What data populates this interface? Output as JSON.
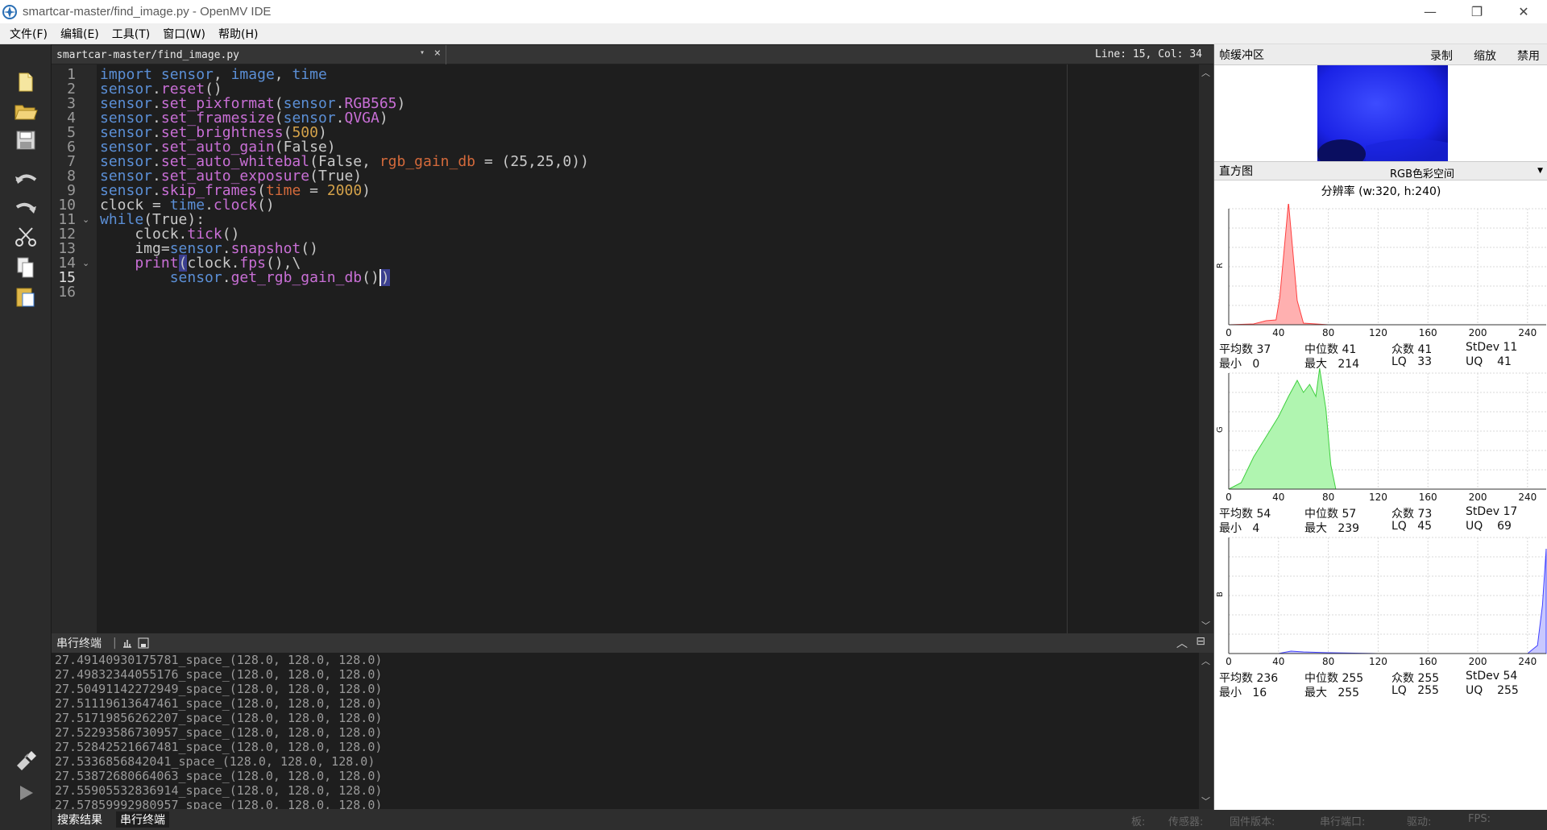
{
  "window": {
    "title": "smartcar-master/find_image.py - OpenMV IDE",
    "minimize": "—",
    "restore": "❐",
    "close": "✕"
  },
  "menu": [
    "文件(F)",
    "编辑(E)",
    "工具(T)",
    "窗口(W)",
    "帮助(H)"
  ],
  "toolbar": {
    "icons": [
      "new-file-icon",
      "open-folder-icon",
      "save-icon",
      "undo-icon",
      "redo-icon",
      "cut-icon",
      "copy-icon",
      "paste-icon",
      "connect-icon",
      "run-icon"
    ]
  },
  "editor": {
    "file_tab": "smartcar-master/find_image.py",
    "tab_dropdown": "▾",
    "tab_close": "×",
    "cursor_pos": "Line: 15, Col: 34",
    "line_numbers": [
      "1",
      "2",
      "3",
      "4",
      "5",
      "6",
      "7",
      "8",
      "9",
      "10",
      "11",
      "12",
      "13",
      "14",
      "15",
      "16"
    ],
    "current_line": 15
  },
  "terminal": {
    "title": "串行终端",
    "lines": [
      "27.49140930175781_space_(128.0, 128.0, 128.0)",
      "27.49832344055176_space_(128.0, 128.0, 128.0)",
      "27.50491142272949_space_(128.0, 128.0, 128.0)",
      "27.51119613647461_space_(128.0, 128.0, 128.0)",
      "27.51719856262207_space_(128.0, 128.0, 128.0)",
      "27.52293586730957_space_(128.0, 128.0, 128.0)",
      "27.52842521667481_space_(128.0, 128.0, 128.0)",
      "27.5336856842041_space_(128.0, 128.0, 128.0)",
      "27.53872680664063_space_(128.0, 128.0, 128.0)",
      "27.55905532836914_space_(128.0, 128.0, 128.0)",
      "27.57859992980957_space_(128.0, 128.0, 128.0)"
    ]
  },
  "statusbar": {
    "tabs": [
      "搜索结果",
      "串行终端"
    ],
    "labels": [
      "板:",
      "传感器:",
      "固件版本:",
      "串行端口:",
      "驱动:",
      "FPS:"
    ]
  },
  "framebuffer": {
    "title": "帧缓冲区",
    "record": "录制",
    "zoom": "缩放",
    "disable": "禁用"
  },
  "histogram": {
    "title": "直方图",
    "colorspace": "RGB色彩空间",
    "resolution": "分辨率 (w:320, h:240)",
    "x_ticks": [
      "0",
      "40",
      "80",
      "120",
      "160",
      "200",
      "240"
    ],
    "stat_labels": {
      "mean": "平均数",
      "median": "中位数",
      "mode": "众数",
      "stdev": "StDev",
      "min": "最小",
      "max": "最大",
      "lq": "LQ",
      "uq": "UQ"
    },
    "channels": [
      {
        "name": "R",
        "color": "#ffb0b0",
        "line": "#ff4040",
        "mean": "37",
        "median": "41",
        "mode": "41",
        "stdev": "11",
        "min": "0",
        "max": "214",
        "lq": "33",
        "uq": "41"
      },
      {
        "name": "G",
        "color": "#b0f5b0",
        "line": "#40d040",
        "mean": "54",
        "median": "57",
        "mode": "73",
        "stdev": "17",
        "min": "4",
        "max": "239",
        "lq": "45",
        "uq": "69"
      },
      {
        "name": "B",
        "color": "#c8c8ff",
        "line": "#4040ff",
        "mean": "236",
        "median": "255",
        "mode": "255",
        "stdev": "54",
        "min": "16",
        "max": "255",
        "lq": "255",
        "uq": "255"
      }
    ]
  }
}
